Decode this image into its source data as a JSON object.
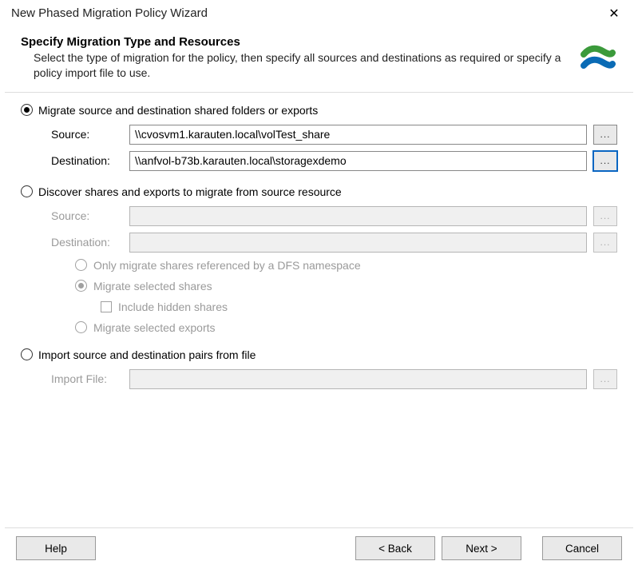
{
  "window": {
    "title": "New Phased Migration Policy Wizard",
    "close_glyph": "✕"
  },
  "header": {
    "title": "Specify Migration Type and Resources",
    "subtitle": "Select the type of migration for the policy, then specify all sources and destinations as required or specify a policy import file to use."
  },
  "options": {
    "migrate": {
      "label": "Migrate source and destination shared folders or exports",
      "selected": true,
      "source_label": "Source:",
      "source_value": "\\\\cvosvm1.karauten.local\\volTest_share",
      "dest_label": "Destination:",
      "dest_value": "\\\\anfvol-b73b.karauten.local\\storagexdemo",
      "browse_label": "..."
    },
    "discover": {
      "label": "Discover shares and exports to migrate from source resource",
      "selected": false,
      "source_label": "Source:",
      "source_value": "",
      "dest_label": "Destination:",
      "dest_value": "",
      "browse_label": "...",
      "sub": {
        "dfs": {
          "label": "Only migrate shares referenced by a DFS namespace",
          "selected": false
        },
        "selected_shares": {
          "label": "Migrate selected shares",
          "selected": true
        },
        "include_hidden": {
          "label": "Include hidden shares",
          "checked": false
        },
        "selected_exports": {
          "label": "Migrate selected exports",
          "selected": false
        }
      }
    },
    "import": {
      "label": "Import source and destination pairs from file",
      "selected": false,
      "file_label": "Import File:",
      "file_value": "",
      "browse_label": "..."
    }
  },
  "buttons": {
    "help": "Help",
    "back": "< Back",
    "next": "Next >",
    "cancel": "Cancel"
  }
}
